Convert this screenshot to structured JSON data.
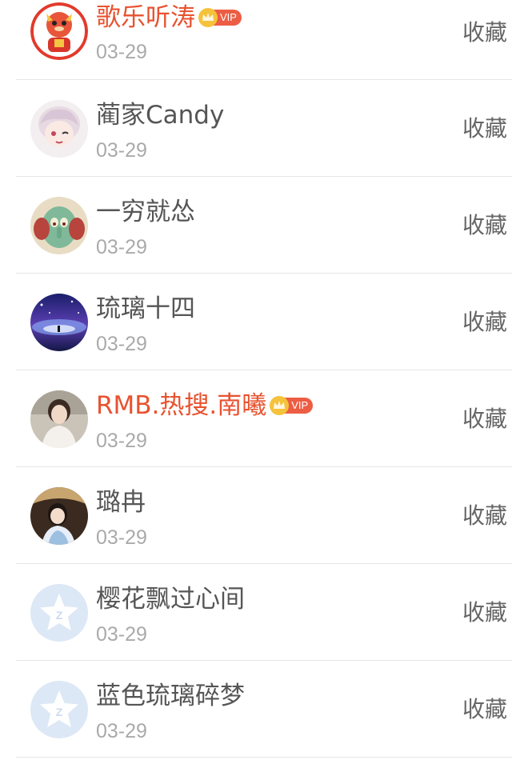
{
  "colors": {
    "vip_name": "#e8522f",
    "name": "#555555",
    "date": "#aaaaaa",
    "action": "#666666",
    "divider": "#e6e6e6",
    "vip_badge": "#ec5d44"
  },
  "users": [
    {
      "name": "歌乐听涛",
      "date": "03-29",
      "vip": true,
      "vip_label": "VIP",
      "action": "收藏",
      "avatar": "lion-mascot-avatar"
    },
    {
      "name": "蔺家Candy",
      "date": "03-29",
      "vip": false,
      "action": "收藏",
      "avatar": "anime-girl-avatar"
    },
    {
      "name": "一穷就怂",
      "date": "03-29",
      "vip": false,
      "action": "收藏",
      "avatar": "squidward-avatar"
    },
    {
      "name": "琉璃十四",
      "date": "03-29",
      "vip": false,
      "action": "收藏",
      "avatar": "night-sky-avatar"
    },
    {
      "name": "RMB.热搜.南曦",
      "date": "03-29",
      "vip": true,
      "vip_label": "VIP",
      "action": "收藏",
      "avatar": "photo-girl-avatar"
    },
    {
      "name": "璐冉",
      "date": "03-29",
      "vip": false,
      "action": "收藏",
      "avatar": "hanfu-girl-avatar"
    },
    {
      "name": "樱花飘过心间",
      "date": "03-29",
      "vip": false,
      "action": "收藏",
      "avatar": "default-star-avatar"
    },
    {
      "name": "蓝色琉璃碎梦",
      "date": "03-29",
      "vip": false,
      "action": "收藏",
      "avatar": "default-star-avatar"
    }
  ]
}
